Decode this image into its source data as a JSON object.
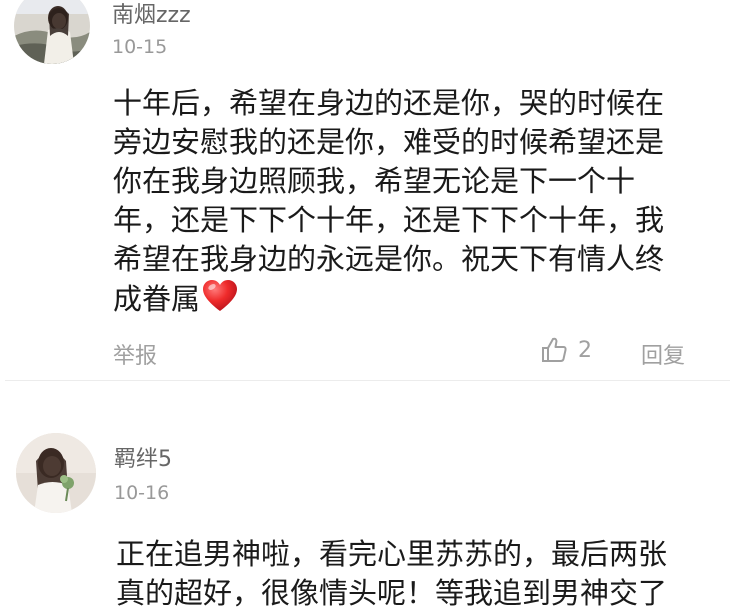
{
  "comments": [
    {
      "username": "南烟zzz",
      "date": "10-15",
      "lines": [
        "十年后，希望在身边的还是你，哭的时候在",
        "旁边安慰我的还是你，难受的时候希望还是",
        "你在我身边照顾我，希望无论是下一个十",
        "年，还是下下个十年，还是下下个十年，我",
        "希望在我身边的永远是你。祝天下有情人终",
        "成眷属"
      ],
      "emoji": "heart-emoji",
      "actions": {
        "report": "举报",
        "like_count": "2",
        "reply": "回复"
      }
    },
    {
      "username": "羁绊5",
      "date": "10-16",
      "lines": [
        "正在追男神啦，看完心里苏苏的，最后两张",
        "真的超好，很像情头呢！等我追到男神交了"
      ]
    }
  ],
  "colors": {
    "text": "#1a1a1a",
    "username": "#666666",
    "meta": "#999999",
    "action": "#a0a0a0",
    "heart": "#e8202a"
  }
}
